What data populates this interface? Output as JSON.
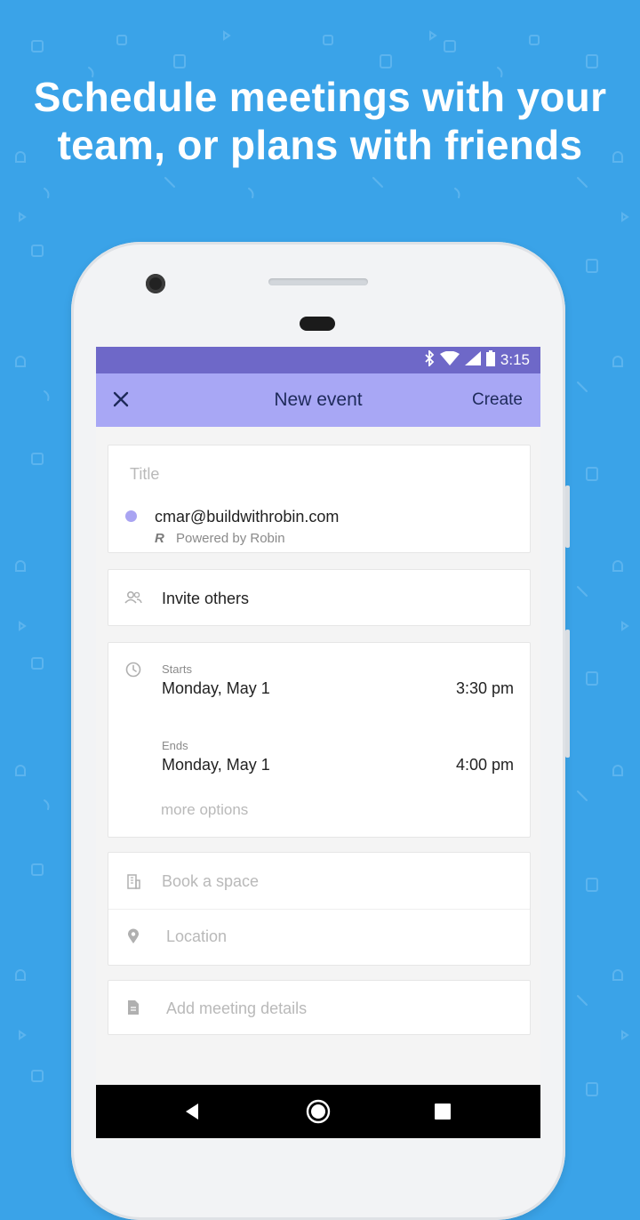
{
  "headline": {
    "line1": "Schedule meetings with your",
    "line2": "team, or plans with friends"
  },
  "status_bar": {
    "time": "3:15",
    "icons": [
      "bluetooth-icon",
      "wifi-icon",
      "signal-icon",
      "battery-icon"
    ]
  },
  "app_bar": {
    "close_icon": "close-icon",
    "title": "New event",
    "action": "Create"
  },
  "title_card": {
    "placeholder": "Title",
    "calendar_email": "cmar@buildwithrobin.com",
    "powered_by_logo": "R",
    "powered_by": "Powered by Robin"
  },
  "invite": {
    "label": "Invite others"
  },
  "time_card": {
    "starts_label": "Starts",
    "starts_date": "Monday, May 1",
    "starts_time": "3:30 pm",
    "ends_label": "Ends",
    "ends_date": "Monday, May 1",
    "ends_time": "4:00 pm",
    "more_options": "more options"
  },
  "space_card": {
    "book_space": "Book a space",
    "location": "Location"
  },
  "details": {
    "placeholder": "Add meeting details"
  },
  "colors": {
    "background": "#3aa3e8",
    "status_bar": "#6e68c8",
    "app_bar": "#a8a7f5",
    "calendar_dot": "#a9a4f2",
    "app_bar_text": "#1e2a5a"
  },
  "nav_bar": {
    "icons": [
      "back-icon",
      "home-icon",
      "recents-icon"
    ]
  }
}
